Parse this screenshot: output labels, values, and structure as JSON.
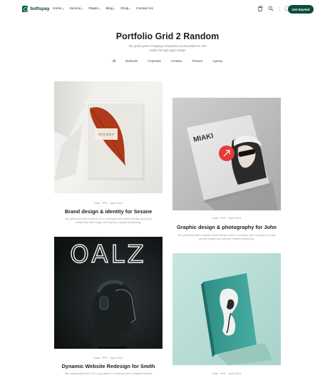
{
  "brand": {
    "name": "Softspay"
  },
  "nav": [
    {
      "label": "Home",
      "has_caret": true
    },
    {
      "label": "Service",
      "has_caret": true
    },
    {
      "label": "Pages",
      "has_caret": true
    },
    {
      "label": "Blog",
      "has_caret": true
    },
    {
      "label": "Shop",
      "has_caret": true
    },
    {
      "label": "Contact Us",
      "has_caret": false
    }
  ],
  "header_icons": [
    "bag-icon",
    "search-icon",
    "user-icon"
  ],
  "cta": {
    "label": "Get Started"
  },
  "hero": {
    "title": "Portfolio Grid 2 Random",
    "intro": "We guide game-changing companies across platforms and scales through agile ratings"
  },
  "filters": [
    "All",
    "Business",
    "Corporate",
    "Creative",
    "Finance",
    "Agency"
  ],
  "projects": [
    {
      "category": "Data",
      "date": "April 2024",
      "title": "Brand design & identity for Sezane",
      "description": "We partnered with Creative AG to redesign their brand identity, aiming to modernize their image and improve market positioning."
    },
    {
      "category": "Data",
      "date": "April 2024",
      "title": "Graphic design & photography for John",
      "description": "We partnered with Creative Work Romano Dell to revitalize their concepts, to help up their image and improve market positioning."
    },
    {
      "category": "Data",
      "date": "April 2024",
      "title": "Dynamic Website Redesign for Smith",
      "description": "We collaborated with XYZ Corporation to redesign their outdated website"
    },
    {
      "category": "Data",
      "date": "April 2024",
      "title": "",
      "description": ""
    }
  ],
  "images": {
    "card1_label": "WOCKET",
    "card2_label": "MIAKI",
    "card3_label": "OALZ"
  },
  "colors": {
    "brand_dark": "#0e4d3d",
    "accent_red": "#e63b3b",
    "teal_book": "#3fa39a"
  }
}
